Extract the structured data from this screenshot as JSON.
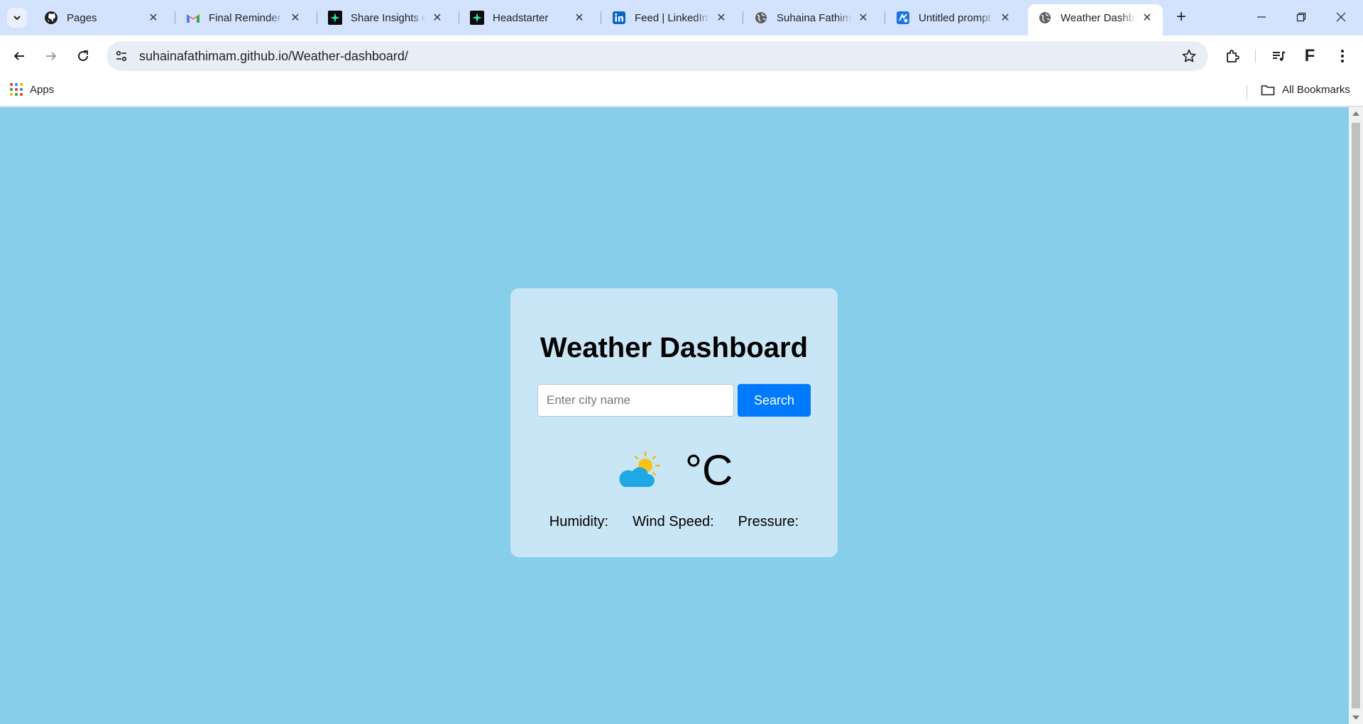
{
  "browser": {
    "tabs": [
      {
        "title": "Pages",
        "favicon": "github-icon"
      },
      {
        "title": "Final Reminder | Completion of",
        "favicon": "gmail-icon"
      },
      {
        "title": "Share Insights on",
        "favicon": "headstarter-icon"
      },
      {
        "title": "Headstarter",
        "favicon": "headstarter-icon"
      },
      {
        "title": "Feed | LinkedIn",
        "favicon": "linkedin-icon"
      },
      {
        "title": "Suhaina Fathima",
        "favicon": "globe-icon"
      },
      {
        "title": "Untitled prompt",
        "favicon": "ai-studio-icon"
      },
      {
        "title": "Weather Dashboard",
        "favicon": "globe-icon",
        "active": true
      }
    ],
    "address_bar": {
      "url": "suhainafathimam.github.io/Weather-dashboard/"
    },
    "profile_initial": "F",
    "bookmarks": {
      "apps_label": "Apps",
      "all_bookmarks_label": "All Bookmarks"
    }
  },
  "page": {
    "background_color": "#87ceeb",
    "card": {
      "title": "Weather Dashboard",
      "search": {
        "placeholder": "Enter city name",
        "value": "",
        "button_label": "Search"
      },
      "weather_icon": "partly-cloudy-icon",
      "temperature": "°C",
      "stats": {
        "humidity_label": "Humidity:",
        "wind_speed_label": "Wind Speed:",
        "pressure_label": "Pressure:"
      }
    },
    "accent_color": "#007bff"
  }
}
